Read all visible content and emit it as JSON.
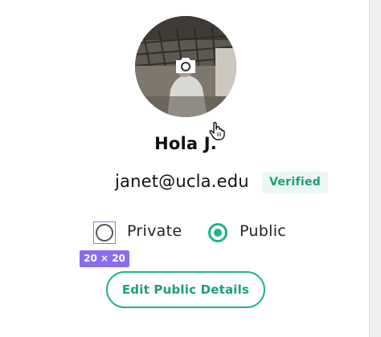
{
  "profile": {
    "name": "Hola J.",
    "email": "janet@ucla.edu",
    "verified_label": "Verified",
    "avatar_icon": "camera-icon"
  },
  "visibility": {
    "options": [
      {
        "label": "Private",
        "selected": false
      },
      {
        "label": "Public",
        "selected": true
      }
    ],
    "inspector_badge": "20 × 20"
  },
  "actions": {
    "edit_label": "Edit Public Details"
  },
  "colors": {
    "accent": "#1eb48a",
    "accent_text": "#1e9e7c",
    "verified_bg": "#eaf7f2",
    "inspector": "#8b6cf0"
  }
}
